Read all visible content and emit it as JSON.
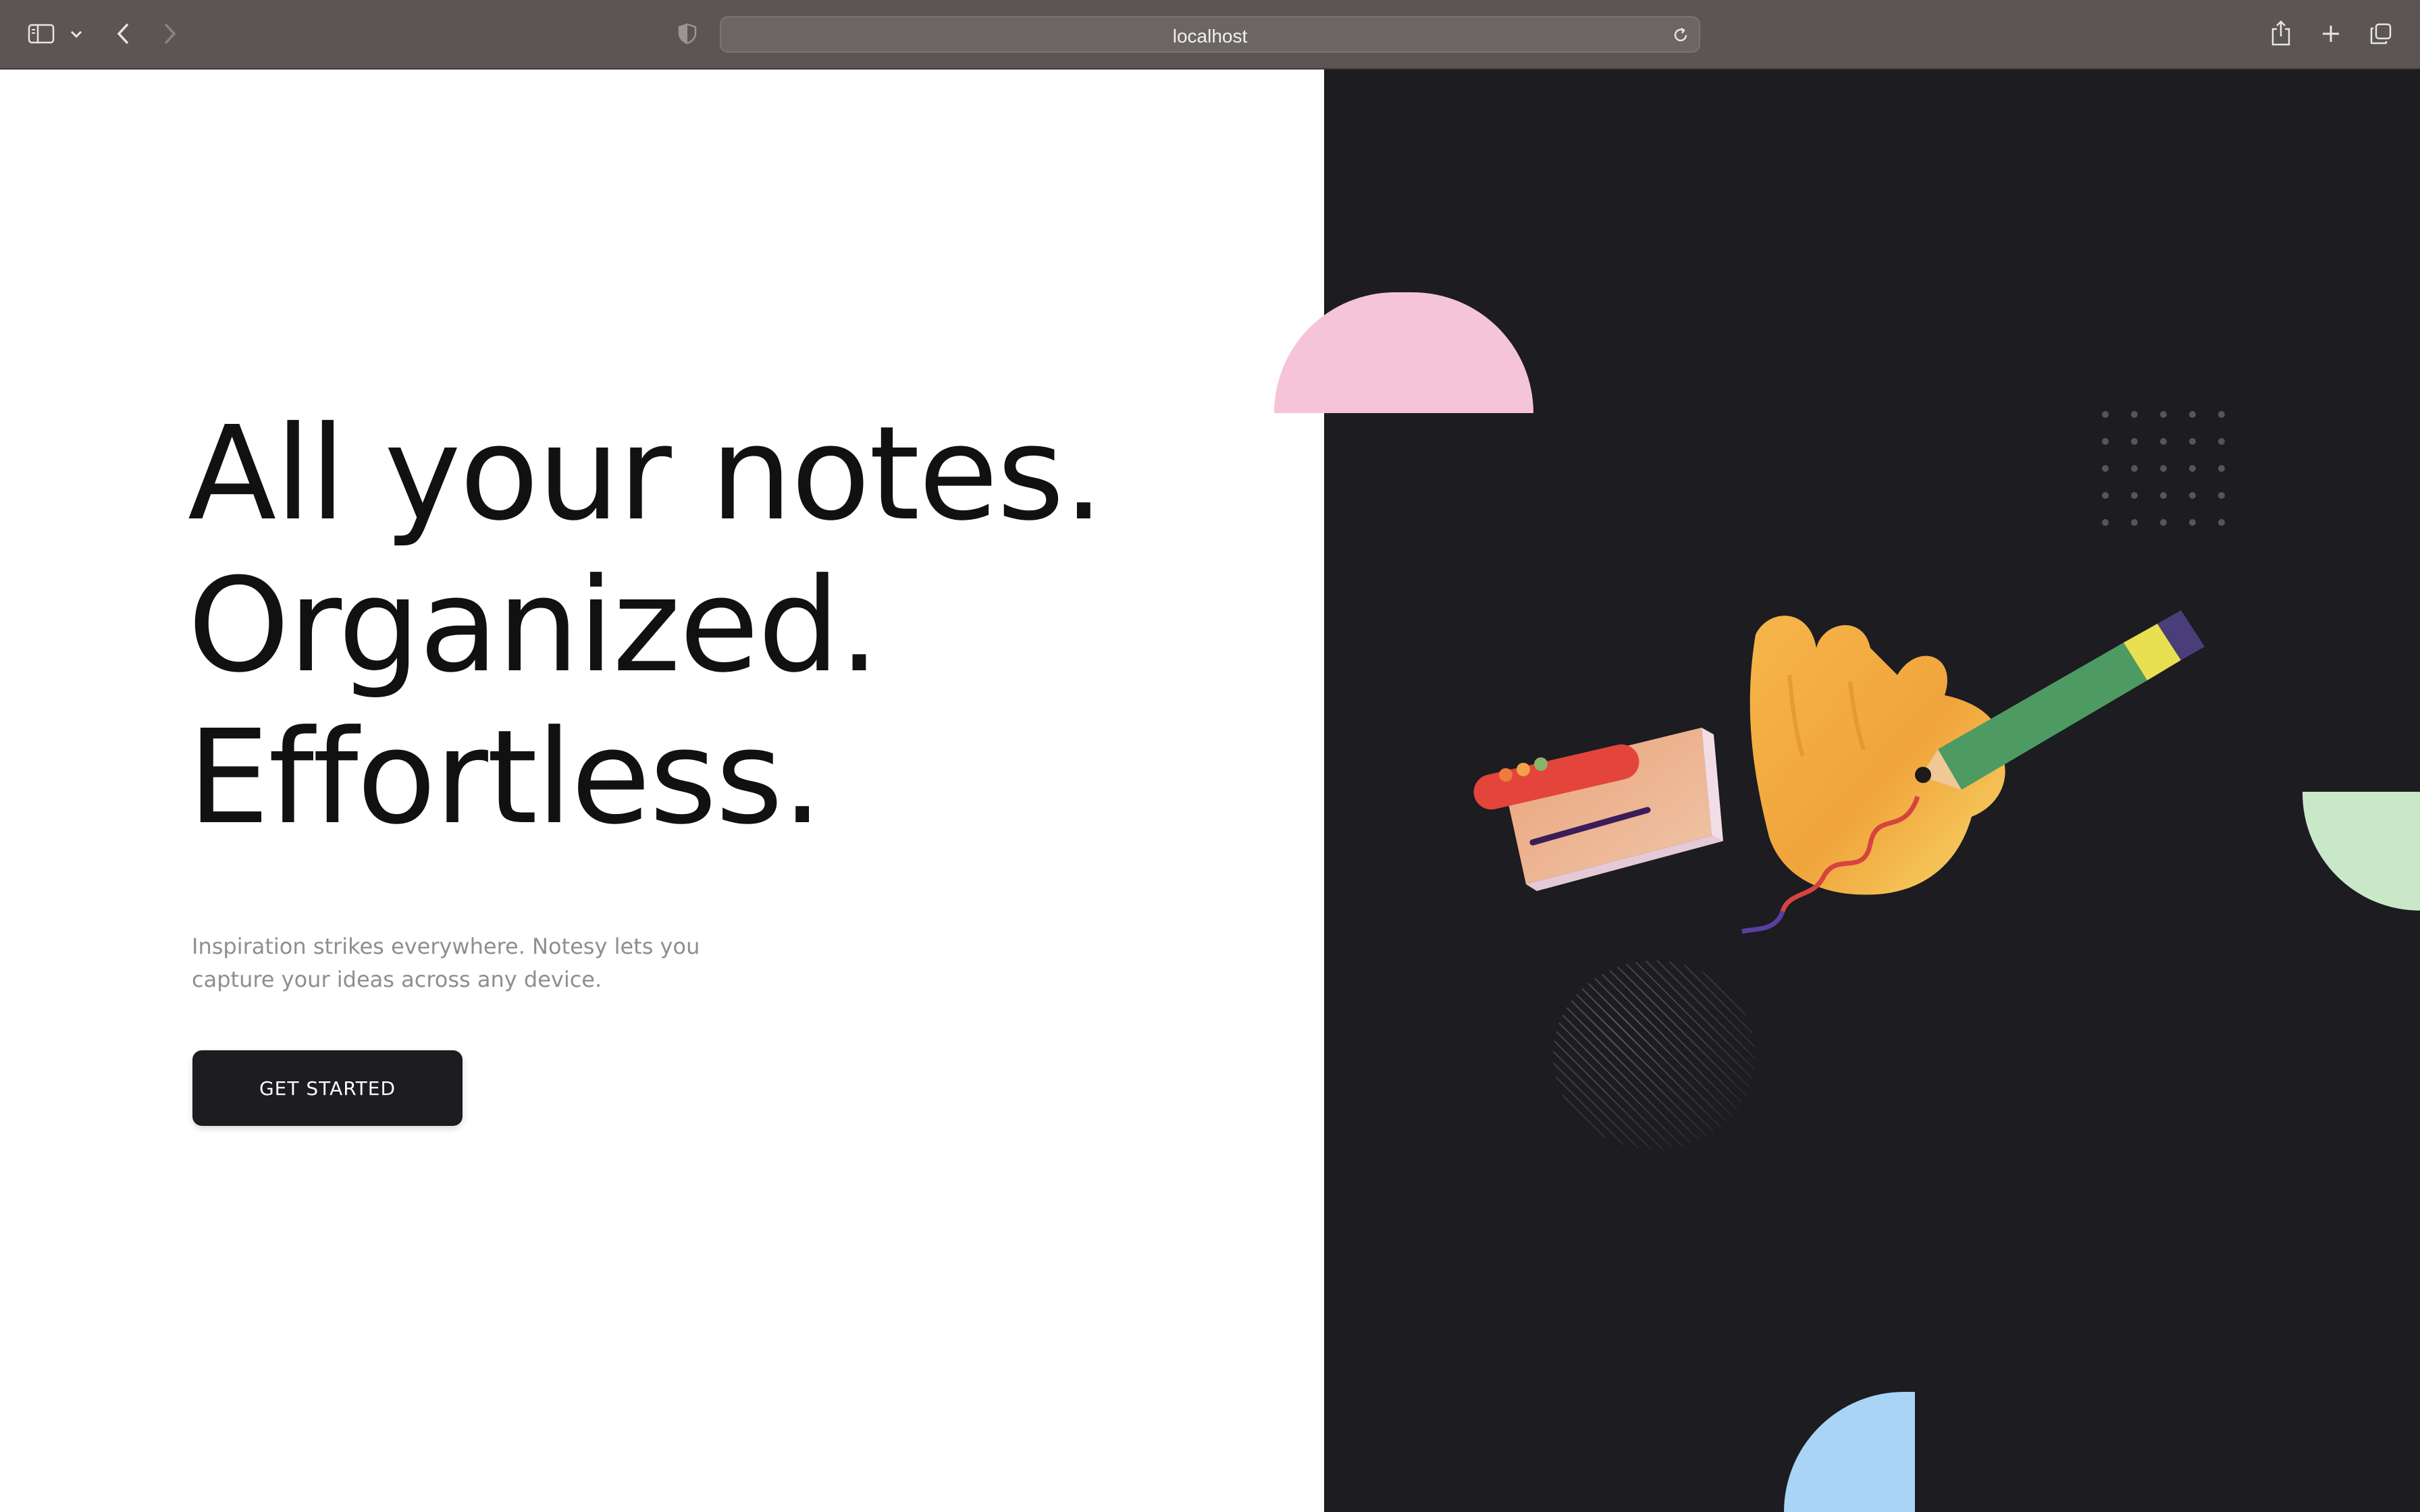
{
  "browser": {
    "url": "localhost",
    "icons": {
      "sidebar": "sidebar-icon",
      "tab_menu": "chevron-down-icon",
      "back": "back-arrow-icon",
      "forward": "forward-arrow-icon",
      "privacy": "shield-icon",
      "reload": "reload-icon",
      "share": "share-icon",
      "new_tab": "plus-icon",
      "tabs": "tab-overview-icon"
    }
  },
  "hero": {
    "headline_line1": "All your notes.",
    "headline_line2": "Organized.",
    "headline_line3": "Effortless.",
    "subtitle": "Inspiration strikes everywhere. Notesy lets you capture your ideas across any device.",
    "cta_label": "GET STARTED"
  },
  "colors": {
    "dark_panel": "#1c1c21",
    "pink_shape": "#f5c4d8",
    "green_shape": "#c9e8c8",
    "blue_shape": "#a9d4f5",
    "button_bg": "#1c1c21"
  }
}
